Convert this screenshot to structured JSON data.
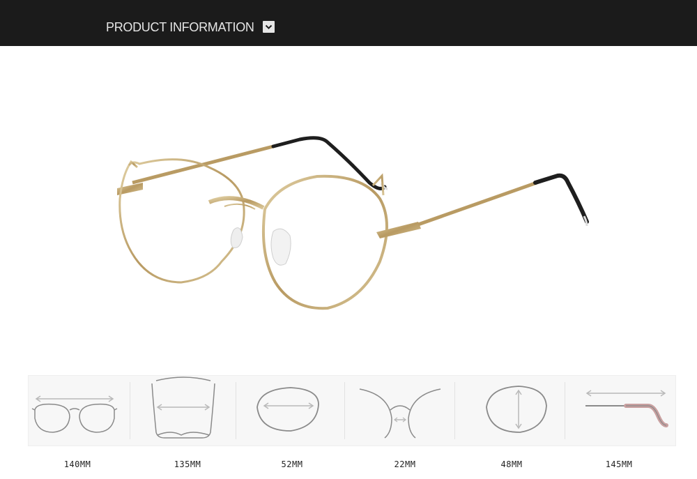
{
  "header": {
    "title": "PRODUCT INFORMATION",
    "icon": "chevron-down-icon"
  },
  "product": {
    "icon": "glasses-image"
  },
  "measurements": [
    {
      "label": "140MM",
      "icon": "frame-width-icon"
    },
    {
      "label": "135MM",
      "icon": "temple-spread-icon"
    },
    {
      "label": "52MM",
      "icon": "lens-width-icon"
    },
    {
      "label": "22MM",
      "icon": "bridge-width-icon"
    },
    {
      "label": "48MM",
      "icon": "lens-height-icon"
    },
    {
      "label": "145MM",
      "icon": "temple-length-icon"
    }
  ],
  "colors": {
    "header_bg": "#1b1b1b",
    "frame_gold": "#c8b07a",
    "temple_tip": "#1e1e1e",
    "diagram_line": "#8a8a8a",
    "arrow": "#b9b9b9"
  }
}
